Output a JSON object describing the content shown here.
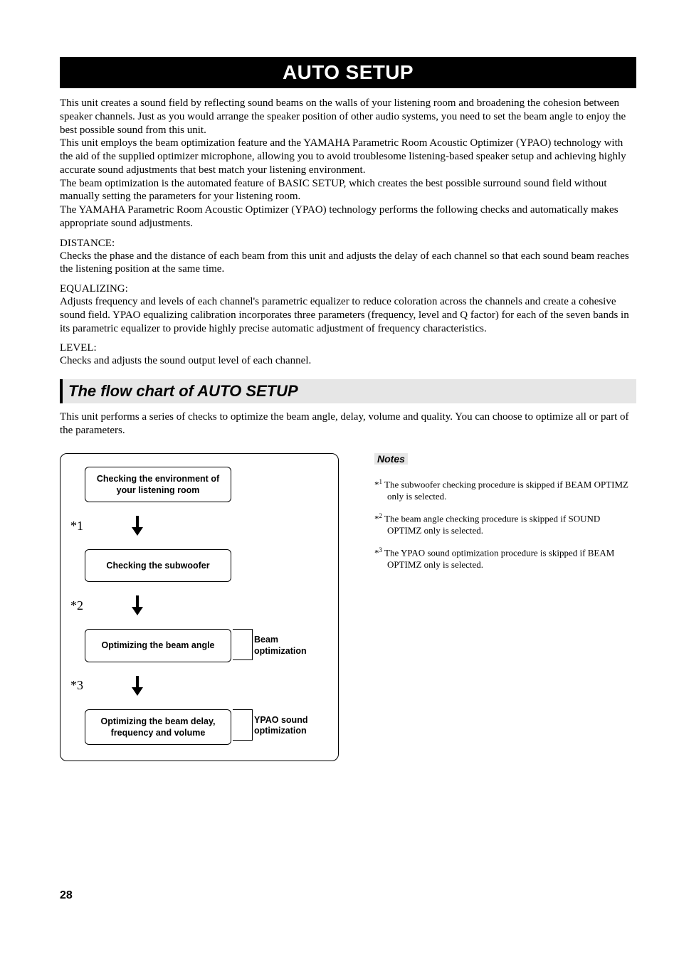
{
  "page": {
    "title_banner": "AUTO SETUP",
    "page_number": "28"
  },
  "intro": {
    "p1": "This unit creates a sound field by reflecting sound beams on the walls of your listening room and broadening the cohesion between speaker channels. Just as you would arrange the speaker position of other audio systems, you need to set the beam angle to enjoy the best possible sound from this unit.",
    "p2": "This unit employs the beam optimization feature and the YAMAHA Parametric Room Acoustic Optimizer (YPAO) technology with the aid of the supplied optimizer microphone, allowing you to avoid troublesome listening-based speaker setup and achieving highly accurate sound adjustments that best match your listening environment.",
    "p3": "The beam optimization is the automated feature of BASIC SETUP, which creates the best possible surround sound field without manually setting the parameters for your listening room.",
    "p4": "The YAMAHA Parametric Room Acoustic Optimizer (YPAO) technology performs the following checks and automatically makes appropriate sound adjustments."
  },
  "sections": {
    "distance_h": "DISTANCE:",
    "distance_b": "Checks the phase and the distance of each beam from this unit and adjusts the delay of each channel so that each sound beam reaches the listening position at the same time.",
    "eq_h": "EQUALIZING:",
    "eq_b": "Adjusts frequency and levels of each channel's parametric equalizer to reduce coloration across the channels and create a cohesive sound field. YPAO equalizing calibration incorporates three parameters (frequency, level and Q factor) for each of the seven bands in its parametric equalizer to provide highly precise automatic adjustment of frequency characteristics.",
    "level_h": "LEVEL:",
    "level_b": "Checks and adjusts the sound output level of each channel."
  },
  "flow_section": {
    "heading": "The flow chart of AUTO SETUP",
    "intro": "This unit performs a series of checks to optimize the beam angle, delay, volume and quality. You can choose to optimize all or part of the parameters."
  },
  "flow": {
    "box1": "Checking the environment of your listening room",
    "star1": "*1",
    "box2": "Checking the subwoofer",
    "star2": "*2",
    "box3": "Optimizing the beam angle",
    "side3": "Beam optimization",
    "star3": "*3",
    "box4": "Optimizing the beam delay, frequency and volume",
    "side4": "YPAO sound optimization"
  },
  "notes": {
    "heading": "Notes",
    "n1_mark": "*",
    "n1_num": "1",
    "n1_text": " The subwoofer checking procedure is skipped if BEAM OPTIMZ only is selected.",
    "n2_mark": "*",
    "n2_num": "2",
    "n2_text": " The beam angle checking procedure is skipped if SOUND OPTIMZ only is selected.",
    "n3_mark": "*",
    "n3_num": "3",
    "n3_text": " The YPAO sound optimization procedure is skipped if BEAM OPTIMZ only is selected."
  }
}
